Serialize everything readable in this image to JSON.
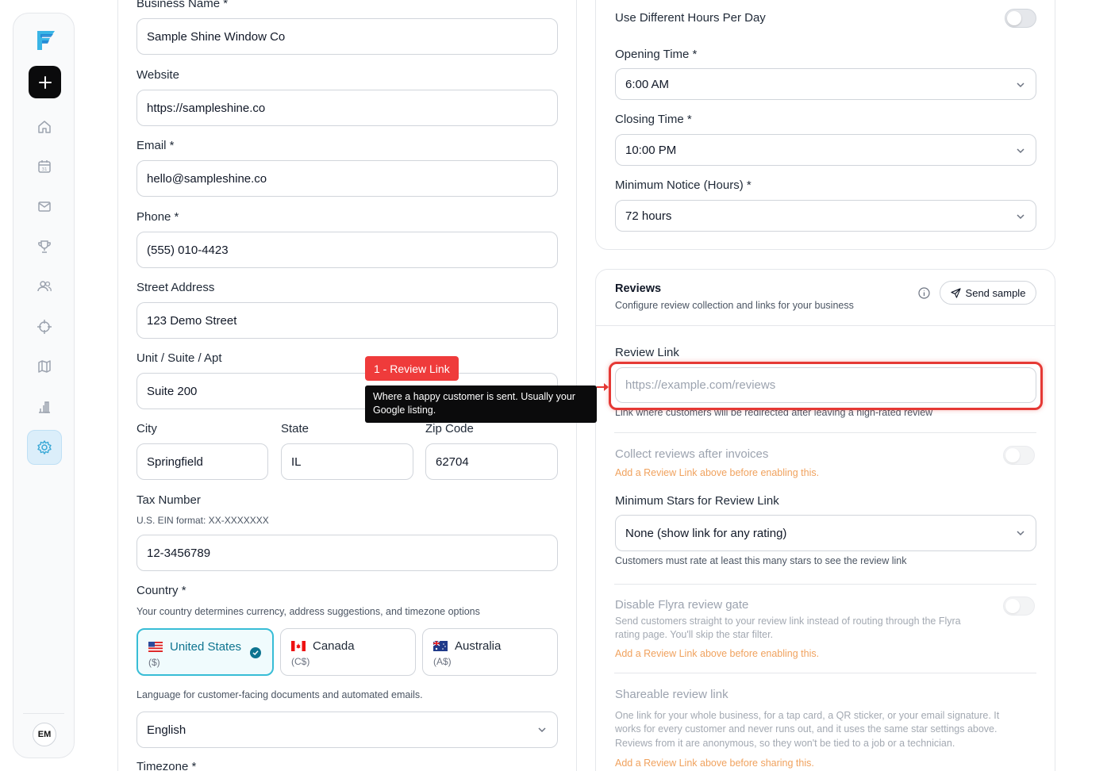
{
  "sidebar": {
    "avatar_initials": "EM",
    "nav": [
      {
        "icon": "home-icon"
      },
      {
        "icon": "calendar-icon",
        "text": "31"
      },
      {
        "icon": "mail-icon"
      },
      {
        "icon": "trophy-icon"
      },
      {
        "icon": "users-icon"
      },
      {
        "icon": "crosshair-icon"
      },
      {
        "icon": "map-icon"
      },
      {
        "icon": "chart-icon"
      },
      {
        "icon": "gear-icon"
      }
    ]
  },
  "business": {
    "name_label": "Business Name *",
    "name_value": "Sample Shine Window Co",
    "website_label": "Website",
    "website_value": "https://sampleshine.co",
    "email_label": "Email *",
    "email_value": "hello@sampleshine.co",
    "phone_label": "Phone *",
    "phone_value": "(555) 010-4423",
    "street_label": "Street Address",
    "street_value": "123 Demo Street",
    "unit_label": "Unit / Suite / Apt",
    "unit_value": "Suite 200",
    "city_label": "City",
    "city_value": "Springfield",
    "state_label": "State",
    "state_value": "IL",
    "zip_label": "Zip Code",
    "zip_value": "62704",
    "tax_label": "Tax Number",
    "tax_helper": "U.S. EIN format: XX-XXXXXXX",
    "tax_value": "12-3456789",
    "country_label": "Country *",
    "country_helper": "Your country determines currency, address suggestions, and timezone options",
    "countries": [
      {
        "name": "United States",
        "symbol": "($)",
        "selected": true
      },
      {
        "name": "Canada",
        "symbol": "(C$)",
        "selected": false
      },
      {
        "name": "Australia",
        "symbol": "(A$)",
        "selected": false
      }
    ],
    "language_helper": "Language for customer-facing documents and automated emails.",
    "language_value": "English",
    "timezone_label": "Timezone *"
  },
  "hours": {
    "different_hours_label": "Use Different Hours Per Day",
    "opening_label": "Opening Time *",
    "opening_value": "6:00 AM",
    "closing_label": "Closing Time *",
    "closing_value": "10:00 PM",
    "notice_label": "Minimum Notice (Hours) *",
    "notice_value": "72 hours"
  },
  "reviews": {
    "title": "Reviews",
    "subtitle": "Configure review collection and links for your business",
    "send_sample": "Send sample",
    "link_label": "Review Link",
    "link_placeholder": "https://example.com/reviews",
    "link_helper": "Link where customers will be redirected after leaving a high-rated review",
    "collect_label": "Collect reviews after invoices",
    "collect_warn": "Add a Review Link above before enabling this.",
    "min_stars_label": "Minimum Stars for Review Link",
    "min_stars_value": "None (show link for any rating)",
    "min_stars_helper": "Customers must rate at least this many stars to see the review link",
    "gate_label": "Disable Flyra review gate",
    "gate_desc_1": "Send customers straight to your review link instead of routing through the Flyra",
    "gate_desc_2": "rating page. You'll skip the star filter.",
    "gate_warn": "Add a Review Link above before enabling this.",
    "share_label": "Shareable review link",
    "share_desc_1": "One link for your whole business, for a tap card, a QR sticker, or your email signature. It",
    "share_desc_2": "works for every customer and never runs out, and it uses the same star settings above.",
    "share_desc_3": "Reviews from it are anonymous, so they won't be tied to a job or a technician.",
    "share_warn": "Add a Review Link above before sharing this."
  },
  "annotation": {
    "badge": "1 - Review Link",
    "tooltip_line1": "Where a happy customer is sent. Usually your",
    "tooltip_line2": "Google listing."
  },
  "colors": {
    "accent": "#38bdd6",
    "highlight": "#e53935",
    "warning": "#f0a25e"
  }
}
